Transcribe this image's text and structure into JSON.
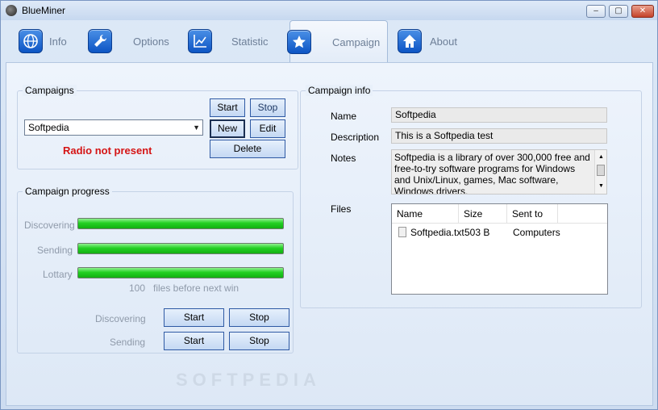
{
  "window": {
    "title": "BlueMiner",
    "minimize_glyph": "–",
    "maximize_glyph": "▢",
    "close_glyph": "✕"
  },
  "tabs": [
    {
      "label": "Info",
      "icon": "globe-icon"
    },
    {
      "label": "Options",
      "icon": "wrench-icon"
    },
    {
      "label": "Statistic",
      "icon": "chart-icon"
    },
    {
      "label": "Campaign",
      "icon": "star-icon"
    },
    {
      "label": "About",
      "icon": "home-icon"
    }
  ],
  "colors": {
    "accent": "#0d55c4",
    "error": "#d51414",
    "progress": "#23d023"
  },
  "campaigns": {
    "title": "Campaigns",
    "selected": "Softpedia",
    "status": "Radio not present",
    "buttons": {
      "start": "Start",
      "stop": "Stop",
      "new": "New",
      "edit": "Edit",
      "delete": "Delete"
    }
  },
  "progress": {
    "title": "Campaign progress",
    "discovering_label": "Discovering",
    "sending_label": "Sending",
    "lottary_label": "Lottary",
    "discovering_value": 1.0,
    "sending_value": 1.0,
    "lottary_value": 1.0,
    "next_win_count": "100",
    "next_win_text": "files before next win",
    "ctrl_discovering_label": "Discovering",
    "ctrl_sending_label": "Sending",
    "discovering_start": "Start",
    "discovering_stop": "Stop",
    "sending_start": "Start",
    "sending_stop": "Stop"
  },
  "info": {
    "title": "Campaign info",
    "name_label": "Name",
    "name_value": "Softpedia",
    "description_label": "Description",
    "description_value": "This is a Softpedia test",
    "notes_label": "Notes",
    "notes_value": "Softpedia is a library of over 300,000 free and free-to-try software programs for Windows and Unix/Linux, games, Mac software, Windows drivers,",
    "files_label": "Files",
    "files_columns": [
      "Name",
      "Size",
      "Sent to"
    ],
    "files_rows": [
      {
        "name": "Softpedia.txt",
        "size": "503 B",
        "sent_to": "Computers"
      }
    ]
  },
  "watermark": "SOFTPEDIA"
}
